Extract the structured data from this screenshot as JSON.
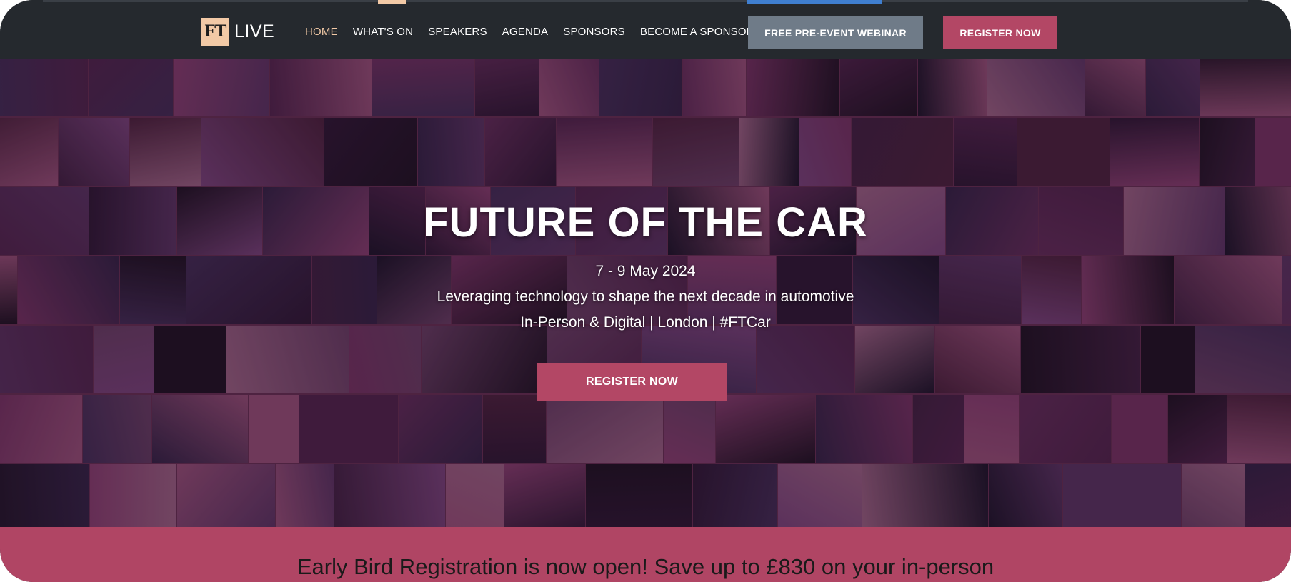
{
  "logo": {
    "mark": "FT",
    "text": "LIVE"
  },
  "nav": {
    "items": [
      {
        "label": "HOME",
        "active": true
      },
      {
        "label": "WHAT'S ON",
        "active": false
      },
      {
        "label": "SPEAKERS",
        "active": false
      },
      {
        "label": "AGENDA",
        "active": false
      },
      {
        "label": "SPONSORS",
        "active": false
      },
      {
        "label": "BECOME A SPONSOR",
        "active": false
      }
    ],
    "webinar_button": "FREE PRE-EVENT WEBINAR",
    "register_button": "REGISTER NOW"
  },
  "hero": {
    "title": "FUTURE OF THE CAR",
    "dates": "7 - 9 May 2024",
    "tagline": "Leveraging technology to shape the next decade in automotive",
    "meta": "In-Person & Digital | London | #FTCar",
    "register_button": "REGISTER NOW",
    "background": "event-photo-mosaic"
  },
  "banner": {
    "text": "Early Bird Registration is now open! Save up to £830 on your in-person"
  },
  "colors": {
    "nav_bg": "#25292e",
    "accent_peach": "#f2c9a6",
    "brand_pink": "#b34765",
    "webinar_grey": "#6f7b88",
    "banner_bg": "#b04564"
  }
}
